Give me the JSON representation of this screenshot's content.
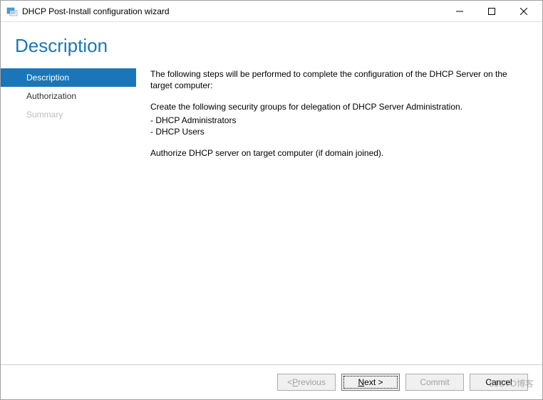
{
  "window": {
    "title": "DHCP Post-Install configuration wizard"
  },
  "header": {
    "page_title": "Description"
  },
  "sidebar": {
    "items": [
      {
        "label": "Description",
        "state": "active"
      },
      {
        "label": "Authorization",
        "state": "normal"
      },
      {
        "label": "Summary",
        "state": "disabled"
      }
    ]
  },
  "content": {
    "intro": "The following steps will be performed to complete the configuration of the DHCP Server on the target computer:",
    "groups_intro": "Create the following security groups for delegation of DHCP Server Administration.",
    "group1": "- DHCP Administrators",
    "group2": "- DHCP Users",
    "authorize": "Authorize DHCP server on target computer (if domain joined)."
  },
  "footer": {
    "previous_prefix": "< ",
    "previous_u": "P",
    "previous_rest": "revious",
    "next_u": "N",
    "next_rest": "ext >",
    "commit": "Commit",
    "cancel": "Cancel"
  },
  "watermark": "51CTO博客"
}
